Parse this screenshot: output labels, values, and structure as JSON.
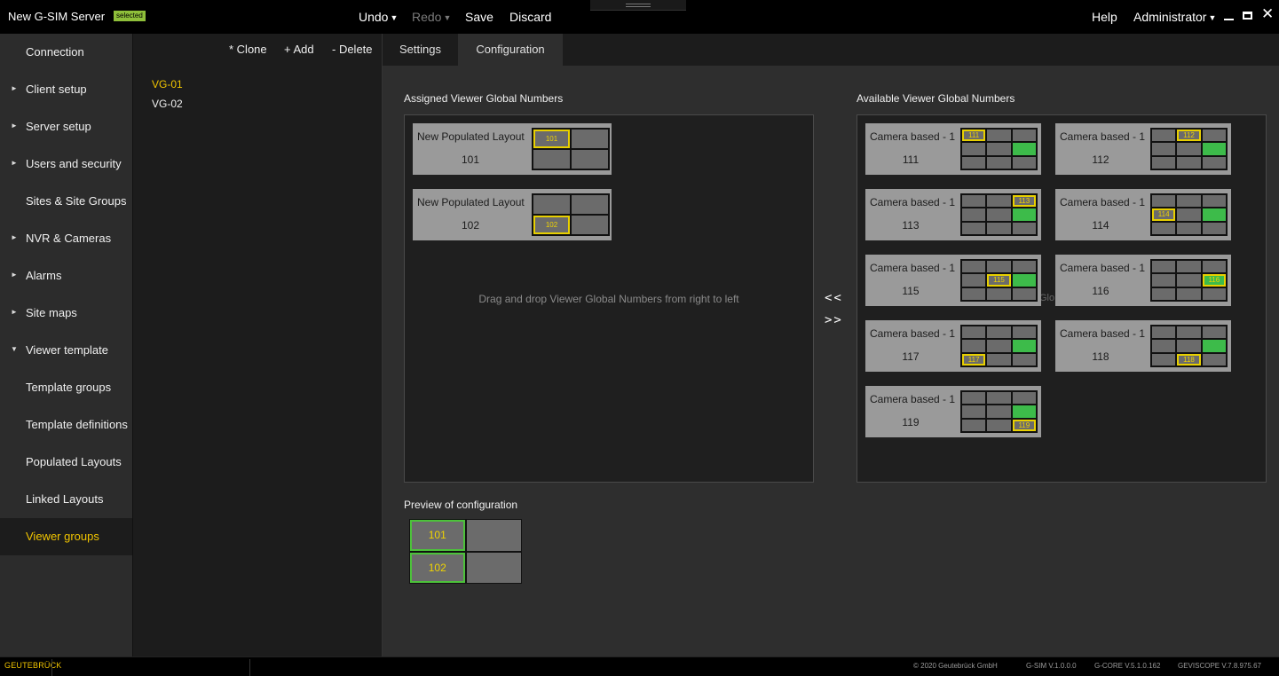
{
  "window": {
    "title": "New G-SIM Server",
    "badge": "selected"
  },
  "toolbar": {
    "undo": "Undo",
    "redo": "Redo",
    "save": "Save",
    "discard": "Discard",
    "help": "Help",
    "user": "Administrator"
  },
  "sidebar": {
    "items": [
      {
        "label": "Connection",
        "arrow": ""
      },
      {
        "label": "Client setup",
        "arrow": "►"
      },
      {
        "label": "Server setup",
        "arrow": "►"
      },
      {
        "label": "Users and security",
        "arrow": "►"
      },
      {
        "label": "Sites & Site Groups",
        "arrow": ""
      },
      {
        "label": "NVR & Cameras",
        "arrow": "►"
      },
      {
        "label": "Alarms",
        "arrow": "►"
      },
      {
        "label": "Site maps",
        "arrow": "►"
      },
      {
        "label": "Viewer template",
        "arrow": "▼"
      },
      {
        "label": "Template groups",
        "arrow": ""
      },
      {
        "label": "Template definitions",
        "arrow": ""
      },
      {
        "label": "Populated Layouts",
        "arrow": ""
      },
      {
        "label": "Linked Layouts",
        "arrow": ""
      },
      {
        "label": "Viewer groups",
        "arrow": "",
        "selected": true
      }
    ]
  },
  "list_actions": {
    "clone": "* Clone",
    "add": "+ Add",
    "delete": "- Delete"
  },
  "viewer_groups": [
    "VG-01",
    "VG-02"
  ],
  "tabs": {
    "settings": "Settings",
    "configuration": "Configuration"
  },
  "assigned": {
    "heading": "Assigned Viewer Global Numbers",
    "hint": "Drag and drop Viewer Global Numbers from right to left",
    "cards": [
      {
        "name": "New Populated Layout",
        "number": "101",
        "marker": "101"
      },
      {
        "name": "New Populated Layout",
        "number": "102",
        "marker": "102"
      }
    ]
  },
  "transfer": {
    "left": "<<",
    "right": ">>"
  },
  "available": {
    "heading": "Available Viewer Global Numbers",
    "ghost_text": "Glo",
    "cards": [
      {
        "name": "Camera based - 1",
        "number": "111",
        "marker": "111"
      },
      {
        "name": "Camera based - 1",
        "number": "112",
        "marker": "112"
      },
      {
        "name": "Camera based - 1",
        "number": "113",
        "marker": "113"
      },
      {
        "name": "Camera based - 1",
        "number": "114",
        "marker": "114"
      },
      {
        "name": "Camera based - 1",
        "number": "115",
        "marker": "115"
      },
      {
        "name": "Camera based - 1",
        "number": "116",
        "marker": "116"
      },
      {
        "name": "Camera based - 1",
        "number": "117",
        "marker": "117"
      },
      {
        "name": "Camera based - 1",
        "number": "118",
        "marker": "118"
      },
      {
        "name": "Camera based - 1",
        "number": "119",
        "marker": "119"
      }
    ]
  },
  "preview": {
    "heading": "Preview of configuration",
    "cells": [
      "101",
      "",
      "102",
      ""
    ]
  },
  "statusbar": {
    "brand": "GEUTEBRÜCK",
    "copyright": "© 2020 Geutebrück GmbH",
    "gsim": "G-SIM V.1.0.0.0",
    "gcore": "G-CORE V.5.1.0.162",
    "geviscope": "GEVISCOPE V.7.8.975.67"
  },
  "colors": {
    "accent": "#f0c400",
    "badge": "#8fbf3a",
    "green": "#3dbb4a",
    "marker": "#e8d000"
  }
}
